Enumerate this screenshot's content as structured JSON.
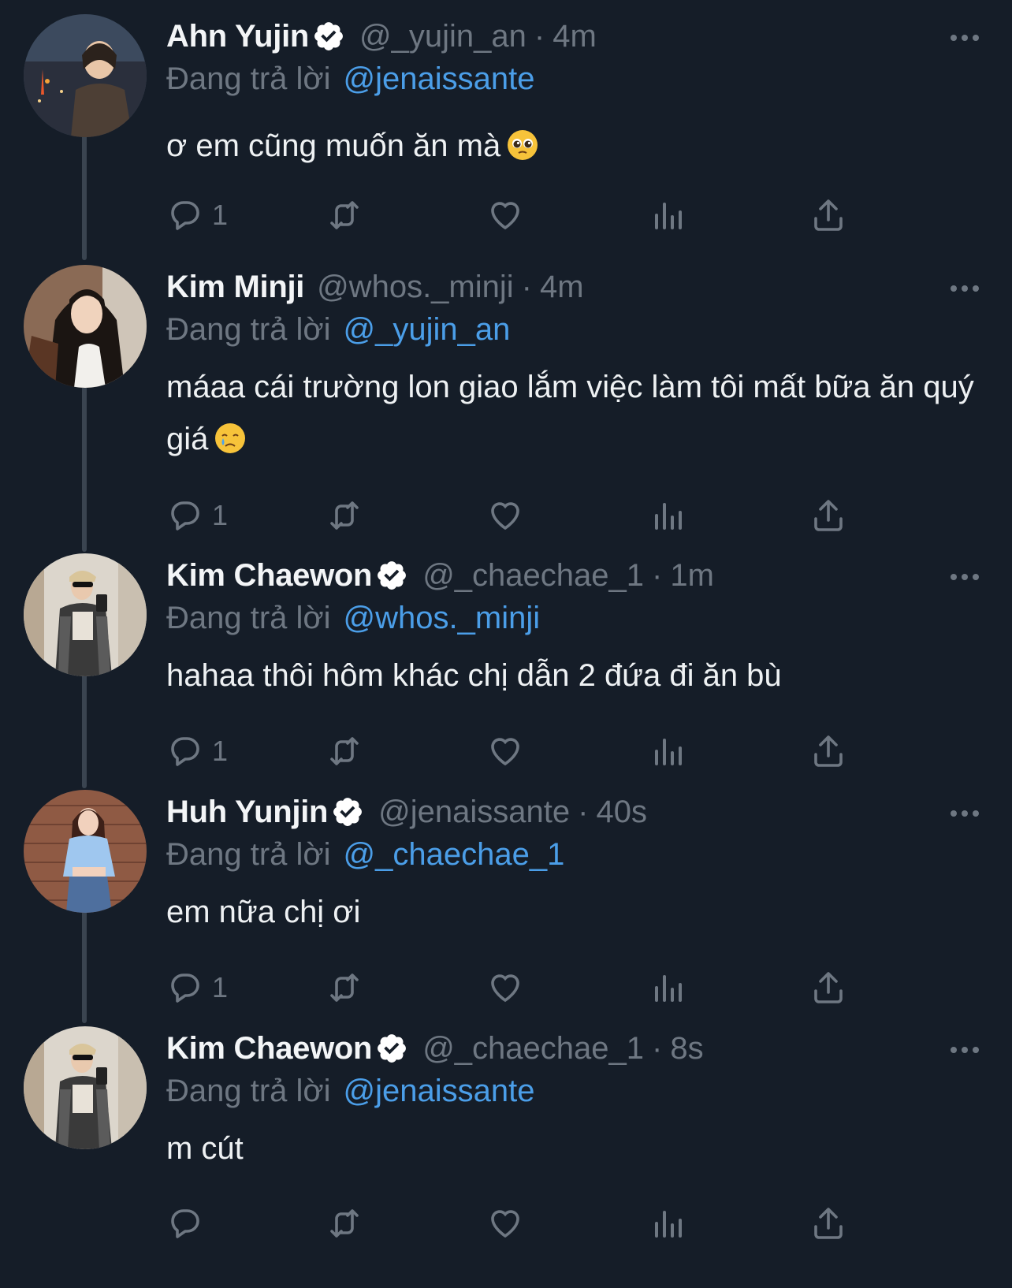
{
  "colors": {
    "background": "#151d28",
    "text": "#eef1f3",
    "muted": "#6e7782",
    "mention": "#4b9ee8",
    "verified": "#ffffff"
  },
  "reply_prefix": "Đang trả lời",
  "tweets": [
    {
      "name": "Ahn Yujin",
      "verified": true,
      "handle": "@_yujin_an",
      "time": "4m",
      "reply_to": "@jenaissante",
      "text": "ơ em cũng muốn ăn mà",
      "emoji": "pleading-face",
      "reply_count": "1"
    },
    {
      "name": "Kim Minji",
      "verified": false,
      "handle": "@whos._minji",
      "time": "4m",
      "reply_to": "@_yujin_an",
      "text": "máaa cái trường lon giao lắm việc làm tôi mất bữa ăn quý giá",
      "emoji": "crying-face",
      "reply_count": "1"
    },
    {
      "name": "Kim Chaewon",
      "verified": true,
      "handle": "@_chaechae_1",
      "time": "1m",
      "reply_to": "@whos._minji",
      "text": "hahaa thôi hôm khác chị dẫn 2 đứa đi ăn bù",
      "emoji": "",
      "reply_count": "1"
    },
    {
      "name": "Huh Yunjin",
      "verified": true,
      "handle": "@jenaissante",
      "time": "40s",
      "reply_to": "@_chaechae_1",
      "text": "em nữa chị ơi",
      "emoji": "",
      "reply_count": "1"
    },
    {
      "name": "Kim Chaewon",
      "verified": true,
      "handle": "@_chaechae_1",
      "time": "8s",
      "reply_to": "@jenaissante",
      "text": "m cút",
      "emoji": "",
      "reply_count": ""
    }
  ]
}
